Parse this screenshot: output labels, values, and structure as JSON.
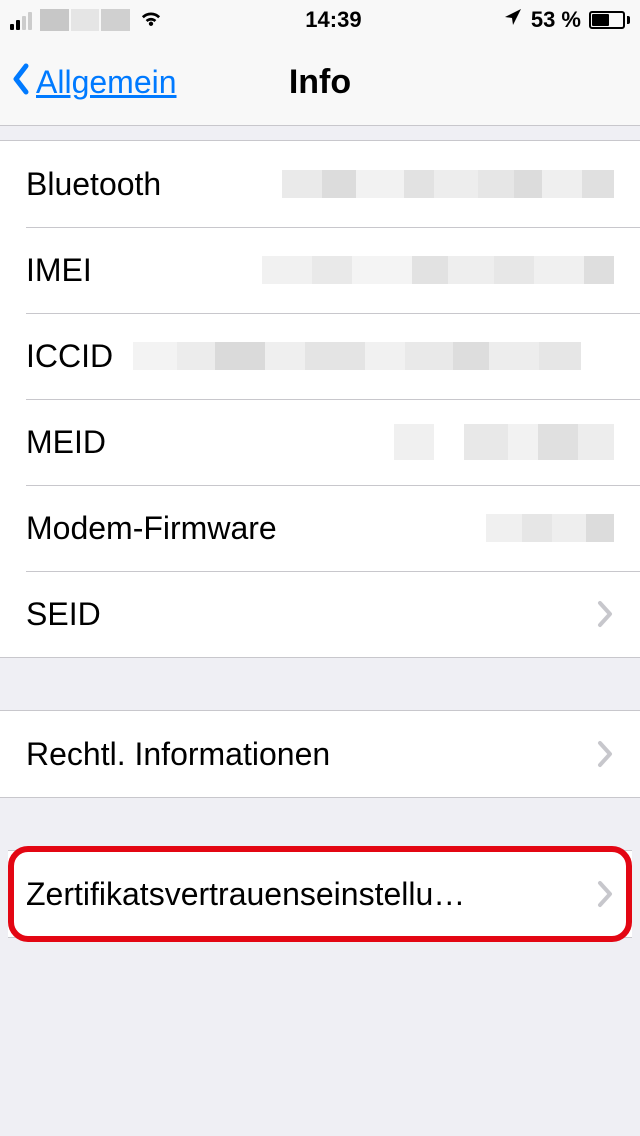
{
  "statusbar": {
    "time": "14:39",
    "battery_text": "53 %"
  },
  "nav": {
    "back_label": "Allgemein",
    "title": "Info"
  },
  "rows": {
    "bluetooth": "Bluetooth",
    "imei": "IMEI",
    "iccid": "ICCID",
    "meid": "MEID",
    "modem": "Modem-Firmware",
    "seid": "SEID",
    "legal": "Rechtl. Informationen",
    "cert_trust": "Zertifikatsvertrauenseinstellu…"
  }
}
